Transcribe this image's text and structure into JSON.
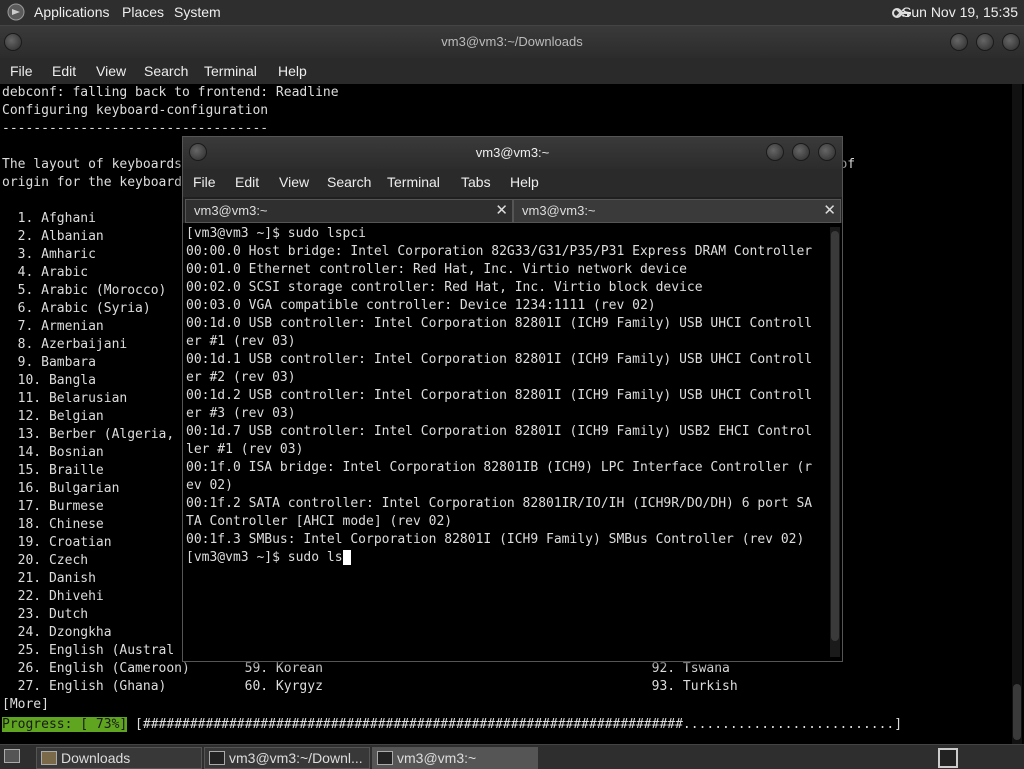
{
  "top_panel": {
    "menus": [
      "Applications",
      "Places",
      "System"
    ],
    "clock": "Sun Nov 19, 15:35"
  },
  "back_window": {
    "title": "vm3@vm3:~/Downloads",
    "menu": [
      "File",
      "Edit",
      "View",
      "Search",
      "Terminal",
      "Help"
    ],
    "lines": [
      "debconf: falling back to frontend: Readline",
      "Configuring keyboard-configuration",
      "----------------------------------",
      "",
      "The layout of keyboards                                                                   lect the country of",
      "origin for the keyboard",
      "",
      "  1. Afghani",
      "  2. Albanian",
      "  3. Amharic",
      "  4. Arabic",
      "  5. Arabic (Morocco)",
      "  6. Arabic (Syria)",
      "  7. Armenian",
      "  8. Azerbaijani",
      "  9. Bambara",
      "  10. Bangla",
      "  11. Belarusian",
      "  12. Belgian",
      "  13. Berber (Algeria,",
      "  14. Bosnian",
      "  15. Braille",
      "  16. Bulgarian",
      "  17. Burmese",
      "  18. Chinese                                                                             )",
      "  19. Croatian",
      "  20. Czech",
      "  21. Danish",
      "  22. Dhivehi",
      "  23. Dutch",
      "  24. Dzongkha",
      "  25. English (Austral",
      "  26. English (Cameroon)       59. Korean                                          92. Tswana",
      "  27. English (Ghana)          60. Kyrgyz                                          93. Turkish",
      "[More] "
    ],
    "progress_label": "Progress: [ 73%]",
    "progress_bar": " [#####################################################################...........................]",
    "progress_percent": 73
  },
  "front_window": {
    "title": "vm3@vm3:~",
    "menu": [
      "File",
      "Edit",
      "View",
      "Search",
      "Terminal",
      "Tabs",
      "Help"
    ],
    "tabs": [
      {
        "label": "vm3@vm3:~"
      },
      {
        "label": "vm3@vm3:~"
      }
    ],
    "lines": [
      "[vm3@vm3 ~]$ sudo lspci",
      "00:00.0 Host bridge: Intel Corporation 82G33/G31/P35/P31 Express DRAM Controller",
      "00:01.0 Ethernet controller: Red Hat, Inc. Virtio network device",
      "00:02.0 SCSI storage controller: Red Hat, Inc. Virtio block device",
      "00:03.0 VGA compatible controller: Device 1234:1111 (rev 02)",
      "00:1d.0 USB controller: Intel Corporation 82801I (ICH9 Family) USB UHCI Controll",
      "er #1 (rev 03)",
      "00:1d.1 USB controller: Intel Corporation 82801I (ICH9 Family) USB UHCI Controll",
      "er #2 (rev 03)",
      "00:1d.2 USB controller: Intel Corporation 82801I (ICH9 Family) USB UHCI Controll",
      "er #3 (rev 03)",
      "00:1d.7 USB controller: Intel Corporation 82801I (ICH9 Family) USB2 EHCI Control",
      "ler #1 (rev 03)",
      "00:1f.0 ISA bridge: Intel Corporation 82801IB (ICH9) LPC Interface Controller (r",
      "ev 02)",
      "00:1f.2 SATA controller: Intel Corporation 82801IR/IO/IH (ICH9R/DO/DH) 6 port SA",
      "TA Controller [AHCI mode] (rev 02)",
      "00:1f.3 SMBus: Intel Corporation 82801I (ICH9 Family) SMBus Controller (rev 02)"
    ],
    "prompt": "[vm3@vm3 ~]$ sudo ls"
  },
  "taskbar": {
    "items": [
      {
        "label": "Downloads",
        "icon": "folder-icon"
      },
      {
        "label": "vm3@vm3:~/Downl...",
        "icon": "terminal-icon"
      },
      {
        "label": "vm3@vm3:~",
        "icon": "terminal-icon"
      }
    ]
  }
}
